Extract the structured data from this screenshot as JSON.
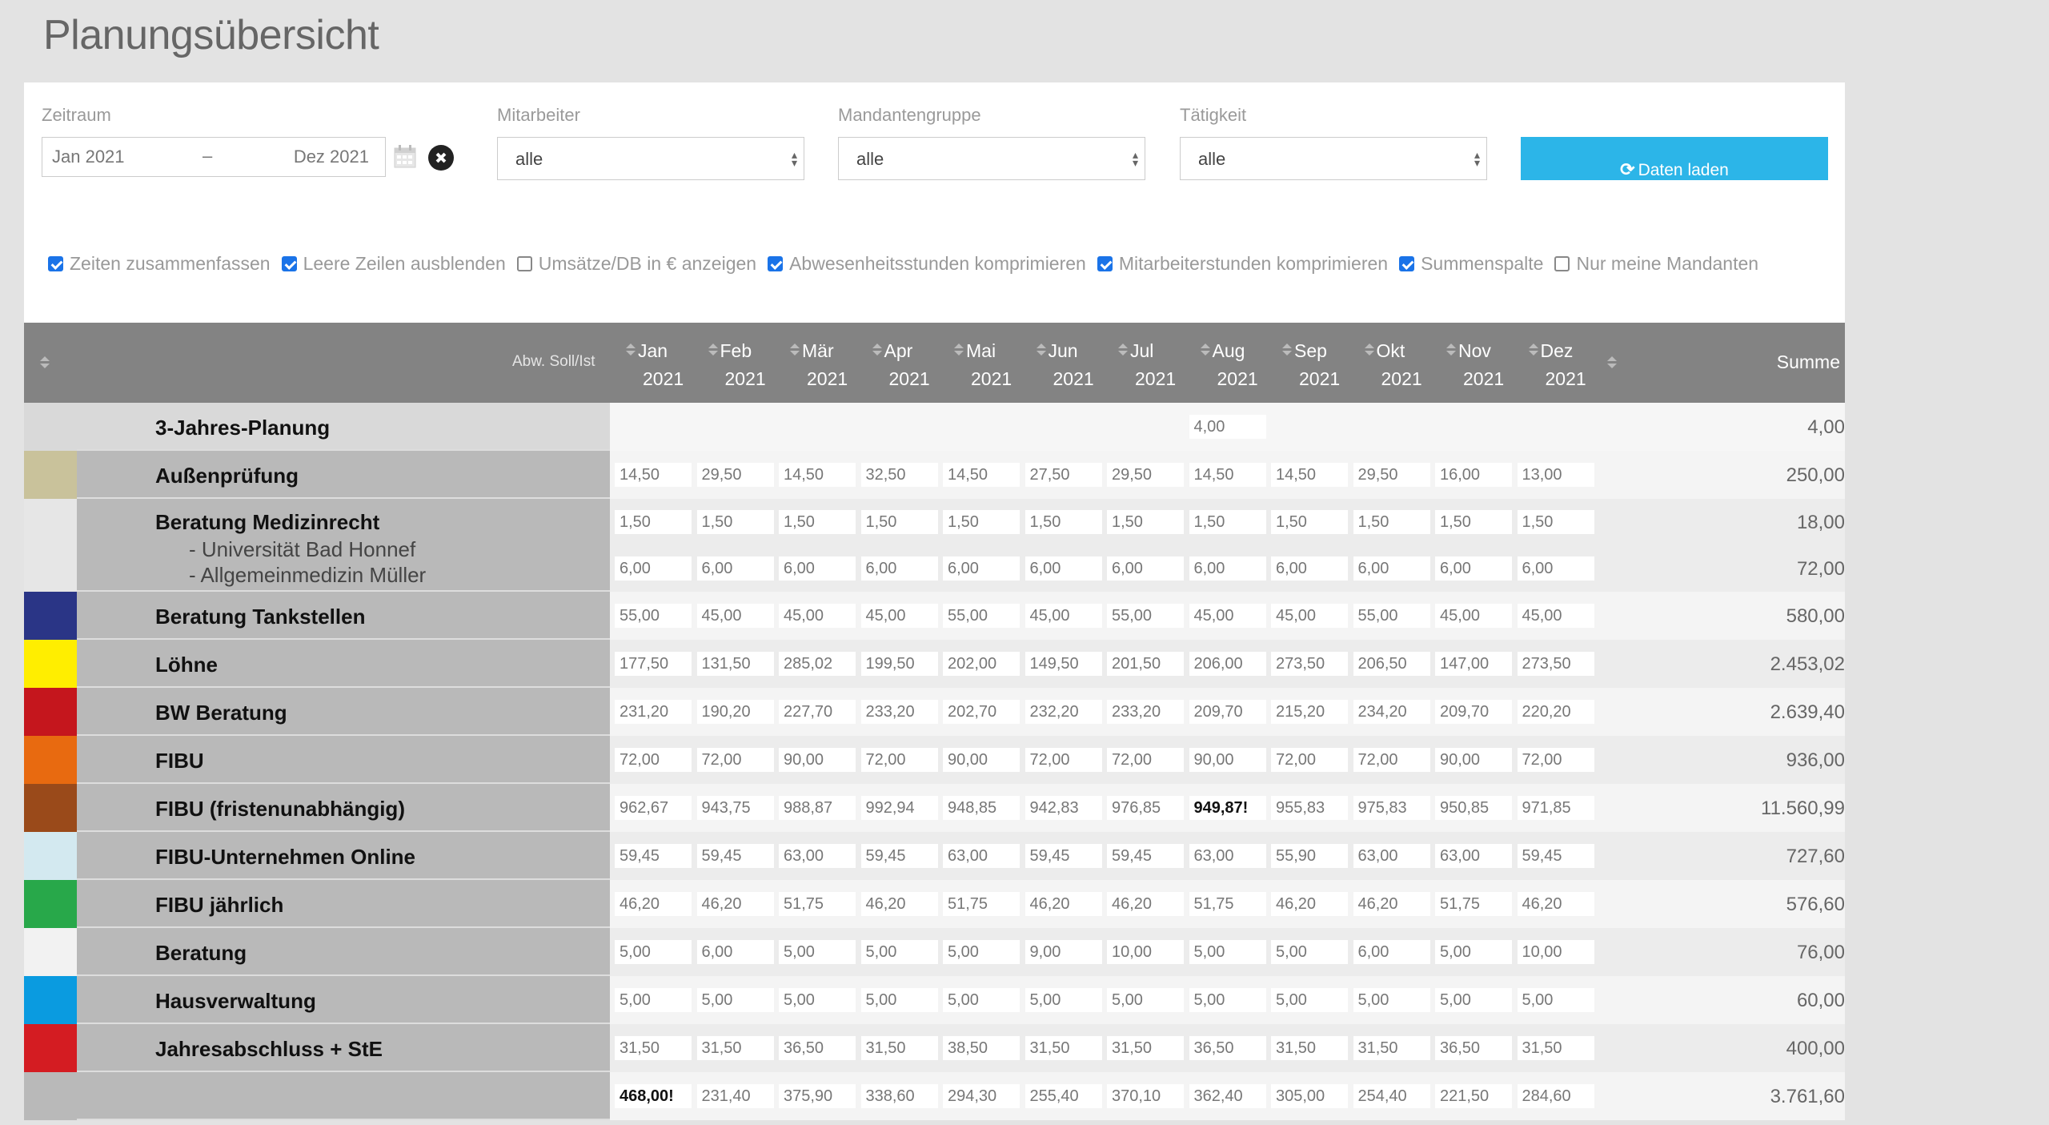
{
  "page_title": "Planungsübersicht",
  "filters": {
    "zeitraum": {
      "label": "Zeitraum",
      "from": "Jan 2021",
      "dash": "–",
      "to": "Dez 2021"
    },
    "mitarbeiter": {
      "label": "Mitarbeiter",
      "value": "alle"
    },
    "mandantengruppe": {
      "label": "Mandantengruppe",
      "value": "alle"
    },
    "taetigkeit": {
      "label": "Tätigkeit",
      "value": "alle"
    },
    "load_button": "Daten laden",
    "icons": {
      "calendar": "calendar-icon",
      "clear": "clear-icon",
      "refresh": "refresh-icon"
    }
  },
  "options": [
    {
      "label": "Zeiten zusammenfassen",
      "checked": true
    },
    {
      "label": "Leere Zeilen ausblenden",
      "checked": true
    },
    {
      "label": "Umsätze/DB in € anzeigen",
      "checked": false
    },
    {
      "label": "Abwesenheitsstunden komprimieren",
      "checked": true
    },
    {
      "label": "Mitarbeiterstunden komprimieren",
      "checked": true
    },
    {
      "label": "Summenspalte",
      "checked": true
    },
    {
      "label": "Nur meine Mandanten",
      "checked": false
    }
  ],
  "grid": {
    "abw_label": "Abw. Soll/Ist",
    "summe_label": "Summe",
    "months": [
      {
        "m": "Jan",
        "y": "2021"
      },
      {
        "m": "Feb",
        "y": "2021"
      },
      {
        "m": "Mär",
        "y": "2021"
      },
      {
        "m": "Apr",
        "y": "2021"
      },
      {
        "m": "Mai",
        "y": "2021"
      },
      {
        "m": "Jun",
        "y": "2021"
      },
      {
        "m": "Jul",
        "y": "2021"
      },
      {
        "m": "Aug",
        "y": "2021"
      },
      {
        "m": "Sep",
        "y": "2021"
      },
      {
        "m": "Okt",
        "y": "2021"
      },
      {
        "m": "Nov",
        "y": "2021"
      },
      {
        "m": "Dez",
        "y": "2021"
      }
    ],
    "rows": [
      {
        "name": "3-Jahres-Planung",
        "color": "#d9d9d9",
        "lines": [
          {
            "values": [
              "",
              "",
              "",
              "",
              "",
              "",
              "",
              "4,00",
              "",
              "",
              "",
              ""
            ],
            "sum": "4,00"
          }
        ],
        "first": true
      },
      {
        "name": "Außenprüfung",
        "color": "#c9c29b",
        "lines": [
          {
            "values": [
              "14,50",
              "29,50",
              "14,50",
              "32,50",
              "14,50",
              "27,50",
              "29,50",
              "14,50",
              "14,50",
              "29,50",
              "16,00",
              "13,00"
            ],
            "sum": "250,00"
          }
        ]
      },
      {
        "name": "Beratung Medizinrecht",
        "color": "#e6e6e6",
        "subs": [
          "- Universität Bad Honnef",
          "- Allgemeinmedizin Müller"
        ],
        "lines": [
          {
            "values": [
              "1,50",
              "1,50",
              "1,50",
              "1,50",
              "1,50",
              "1,50",
              "1,50",
              "1,50",
              "1,50",
              "1,50",
              "1,50",
              "1,50"
            ],
            "sum": "18,00"
          },
          {
            "values": [
              "6,00",
              "6,00",
              "6,00",
              "6,00",
              "6,00",
              "6,00",
              "6,00",
              "6,00",
              "6,00",
              "6,00",
              "6,00",
              "6,00"
            ],
            "sum": "72,00"
          }
        ]
      },
      {
        "name": "Beratung Tankstellen",
        "color": "#2a3586",
        "lines": [
          {
            "values": [
              "55,00",
              "45,00",
              "45,00",
              "45,00",
              "55,00",
              "45,00",
              "55,00",
              "45,00",
              "45,00",
              "55,00",
              "45,00",
              "45,00"
            ],
            "sum": "580,00"
          }
        ]
      },
      {
        "name": "Löhne",
        "color": "#ffee00",
        "lines": [
          {
            "values": [
              "177,50",
              "131,50",
              "285,02",
              "199,50",
              "202,00",
              "149,50",
              "201,50",
              "206,00",
              "273,50",
              "206,50",
              "147,00",
              "273,50"
            ],
            "sum": "2.453,02"
          }
        ]
      },
      {
        "name": "BW Beratung",
        "color": "#c5161d",
        "lines": [
          {
            "values": [
              "231,20",
              "190,20",
              "227,70",
              "233,20",
              "202,70",
              "232,20",
              "233,20",
              "209,70",
              "215,20",
              "234,20",
              "209,70",
              "220,20"
            ],
            "sum": "2.639,40"
          }
        ]
      },
      {
        "name": "FIBU",
        "color": "#e86a10",
        "lines": [
          {
            "values": [
              "72,00",
              "72,00",
              "90,00",
              "72,00",
              "90,00",
              "72,00",
              "72,00",
              "90,00",
              "72,00",
              "72,00",
              "90,00",
              "72,00"
            ],
            "sum": "936,00"
          }
        ]
      },
      {
        "name": "FIBU (fristenunabhängig)",
        "color": "#9a4a1a",
        "lines": [
          {
            "values": [
              "962,67",
              "943,75",
              "988,87",
              "992,94",
              "948,85",
              "942,83",
              "976,85",
              "949,87!",
              "955,83",
              "975,83",
              "950,85",
              "971,85"
            ],
            "sum": "11.560,99",
            "bold_index": 7
          }
        ]
      },
      {
        "name": "FIBU-Unternehmen Online",
        "color": "#d3e9f0",
        "lines": [
          {
            "values": [
              "59,45",
              "59,45",
              "63,00",
              "59,45",
              "63,00",
              "59,45",
              "59,45",
              "63,00",
              "55,90",
              "63,00",
              "63,00",
              "59,45"
            ],
            "sum": "727,60"
          }
        ]
      },
      {
        "name": "FIBU jährlich",
        "color": "#28a84a",
        "lines": [
          {
            "values": [
              "46,20",
              "46,20",
              "51,75",
              "46,20",
              "51,75",
              "46,20",
              "46,20",
              "51,75",
              "46,20",
              "46,20",
              "51,75",
              "46,20"
            ],
            "sum": "576,60"
          }
        ]
      },
      {
        "name": "Beratung",
        "color": "#f2f2f2",
        "lines": [
          {
            "values": [
              "5,00",
              "6,00",
              "5,00",
              "5,00",
              "5,00",
              "9,00",
              "10,00",
              "5,00",
              "5,00",
              "6,00",
              "5,00",
              "10,00"
            ],
            "sum": "76,00"
          }
        ]
      },
      {
        "name": "Hausverwaltung",
        "color": "#0a9be0",
        "lines": [
          {
            "values": [
              "5,00",
              "5,00",
              "5,00",
              "5,00",
              "5,00",
              "5,00",
              "5,00",
              "5,00",
              "5,00",
              "5,00",
              "5,00",
              "5,00"
            ],
            "sum": "60,00"
          }
        ]
      },
      {
        "name": "Jahresabschluss + StE",
        "color": "#d41c22",
        "lines": [
          {
            "values": [
              "31,50",
              "31,50",
              "36,50",
              "31,50",
              "38,50",
              "31,50",
              "31,50",
              "36,50",
              "31,50",
              "31,50",
              "36,50",
              "31,50"
            ],
            "sum": "400,00"
          }
        ]
      },
      {
        "name": "",
        "color": "#b9b9b9",
        "total": true,
        "lines": [
          {
            "values": [
              "468,00!",
              "231,40",
              "375,90",
              "338,60",
              "294,30",
              "255,40",
              "370,10",
              "362,40",
              "305,00",
              "254,40",
              "221,50",
              "284,60"
            ],
            "sum": "3.761,60",
            "bold_index": 0
          }
        ]
      }
    ]
  }
}
